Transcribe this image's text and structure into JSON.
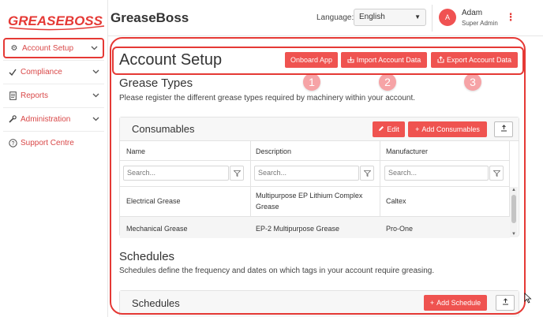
{
  "app": {
    "logo_text": "GREASEBOSS",
    "title": "GreaseBoss"
  },
  "sidebar": {
    "items": [
      {
        "label": "Account Setup",
        "icon": "gear-icon",
        "has_chevron": true,
        "active": true
      },
      {
        "label": "Compliance",
        "icon": "check-icon",
        "has_chevron": true
      },
      {
        "label": "Reports",
        "icon": "document-icon",
        "has_chevron": true
      },
      {
        "label": "Administration",
        "icon": "wrench-icon",
        "has_chevron": true
      },
      {
        "label": "Support Centre",
        "icon": "help-icon",
        "has_chevron": false
      }
    ]
  },
  "header": {
    "language_label": "Language:",
    "language_value": "English",
    "user": {
      "initial": "A",
      "name": "Adam",
      "role": "Super Admin"
    }
  },
  "page": {
    "title": "Account Setup",
    "buttons": {
      "onboard": "Onboard App",
      "import": "Import Account Data",
      "export": "Export Account Data"
    },
    "callouts": [
      "1",
      "2",
      "3"
    ]
  },
  "grease_types": {
    "title": "Grease Types",
    "description": "Please register the different grease types required by machinery within your account.",
    "card_title": "Consumables",
    "edit_label": "Edit",
    "add_label": "Add Consumables",
    "columns": [
      "Name",
      "Description",
      "Manufacturer"
    ],
    "filter_placeholder": "Search...",
    "rows": [
      {
        "name": "Electrical Grease",
        "description_1": "Multipurpose EP Lithium Complex",
        "description_2": "Grease",
        "manufacturer": "Caltex"
      },
      {
        "name": "Mechanical Grease",
        "description_1": "EP-2 Multipurpose Grease",
        "description_2": "",
        "manufacturer": "Pro-One"
      }
    ]
  },
  "schedules": {
    "title": "Schedules",
    "description": "Schedules define the frequency and dates on which tags in your account require greasing.",
    "card_title": "Schedules",
    "add_label": "Add Schedule"
  },
  "colors": {
    "accent": "#ef5350",
    "outline": "#e53935",
    "callout": "#f6a3a6",
    "link_red": "#d94848"
  }
}
